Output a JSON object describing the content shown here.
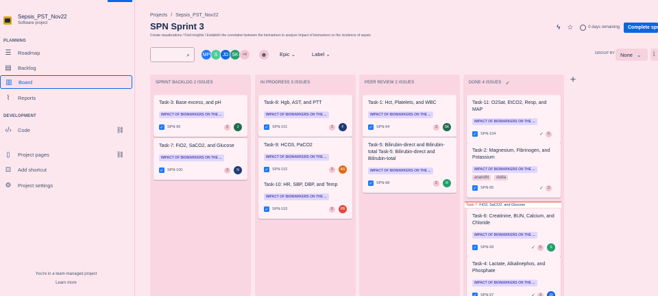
{
  "sidebar": {
    "project_name": "Sepsis_PST_Nov22",
    "project_type": "Software project",
    "planning_heading": "PLANNING",
    "development_heading": "DEVELOPMENT",
    "items": [
      {
        "label": "Roadmap",
        "icon": "roadmap-icon"
      },
      {
        "label": "Backlog",
        "icon": "backlog-icon"
      },
      {
        "label": "Board",
        "icon": "board-icon"
      },
      {
        "label": "Reports",
        "icon": "reports-icon"
      },
      {
        "label": "Code",
        "icon": "code-icon"
      },
      {
        "label": "Project pages",
        "icon": "pages-icon"
      },
      {
        "label": "Add shortcut",
        "icon": "shortcut-icon"
      },
      {
        "label": "Project settings",
        "icon": "settings-icon"
      }
    ],
    "team_note": "You're in a team-managed project",
    "learn_more": "Learn more"
  },
  "header": {
    "breadcrumb_projects": "Projects",
    "breadcrumb_sep": "/",
    "breadcrumb_project": "Sepsis_PST_Nov22",
    "title": "SPN Sprint 3",
    "description": "Create visualizations / Find insights / Establish the correlation between the biomarkers to analyze Impact of biomarkers on the incidence of sepsis",
    "days_remaining": "0 days remaining",
    "complete_sprint": "Complete sprint"
  },
  "filters": {
    "avatars": [
      {
        "initials": "MP",
        "color": "#1d7afc"
      },
      {
        "initials": "S",
        "color": "#4bce97"
      },
      {
        "initials": "JD",
        "color": "#0c66e4"
      },
      {
        "initials": "SK",
        "color": "#22a06b"
      }
    ],
    "more_count": "+6",
    "epic": "Epic",
    "label": "Label",
    "group_by": "GROUP BY",
    "group_value": "None"
  },
  "columns": [
    {
      "header": "SPRINT BACKLOG 2 ISSUES",
      "cards": [
        {
          "title": "Task-3: Base excess, and pH",
          "epic": "IMPACT OF BIOMARKERS ON THE ...",
          "key": "SPN-96",
          "estimate": "2",
          "assignee": "J",
          "assignee_color": "#216e4e"
        },
        {
          "title": "Task-7: FiO2, SaCO2, and Glucose",
          "epic": "IMPACT OF BIOMARKERS ON THE ...",
          "key": "SPN-100",
          "estimate": "3",
          "assignee": "N",
          "assignee_color": "#1f3a75"
        }
      ]
    },
    {
      "header": "IN PROGRESS 3 ISSUES",
      "cards": [
        {
          "title": "Task-8: Hgb, AST, and PTT",
          "epic": "IMPACT OF BIOMARKERS ON THE ...",
          "key": "SPN-101",
          "estimate": "3",
          "assignee": "F",
          "assignee_color": "#1f3a75"
        },
        {
          "title": "Task-9: HCO3, PaCO2",
          "epic": "IMPACT OF BIOMARKERS ON THE ...",
          "key": "SPN-102",
          "estimate": "3",
          "assignee": "AS",
          "assignee_color": "#e56910"
        },
        {
          "title": "Task-10: HR, SBP, DBP, and Temp",
          "epic": "IMPACT OF BIOMARKERS ON THE ...",
          "key": "SPN-103",
          "estimate": "5",
          "assignee": "PB",
          "assignee_color": "#e2483d"
        }
      ]
    },
    {
      "header": "PEER REVIEW 2 ISSUES",
      "cards": [
        {
          "title": "Task-1: Hct, Platelets, and WBC",
          "epic": "IMPACT OF BIOMARKERS ON THE ...",
          "key": "SPN-94",
          "estimate": "3",
          "assignee": "SK",
          "assignee_color": "#216e4e"
        },
        {
          "title": "Task-5: Bilirubin-direct and Bilirubin-total Task-5: Bilirubin-direct and Bilirubin-total",
          "epic": "IMPACT OF BIOMARKERS ON THE ...",
          "key": "SPN-98",
          "estimate": "2",
          "assignee": "R",
          "assignee_color": "#22a06b"
        }
      ]
    },
    {
      "header": "DONE 4 ISSUES",
      "cards": [
        {
          "title": "Task-11: O2Sat, EtCO2, Resp, and MAP",
          "epic": "IMPACT OF BIOMARKERS ON THE ...",
          "key": "SPN-104",
          "estimate": "5",
          "assignee": ""
        },
        {
          "title": "Task-2: Magnesium, Fibrinogen, and Potassium",
          "epic": "IMPACT OF BIOMARKERS ON THE ...",
          "labels": [
            "anandhi",
            "stella"
          ],
          "key": "SPN-95",
          "estimate": "3",
          "assignee": ""
        },
        {
          "title": "Task-6: Creatinine, BUN, Calcium, and Chloride",
          "epic": "IMPACT OF BIOMARKERS ON THE ...",
          "key": "SPN-99",
          "estimate": "5",
          "assignee": "S",
          "assignee_color": "#22a06b"
        },
        {
          "title": "Task-4: Lactate, Alkalinephos, and Phosphate",
          "epic": "IMPACT OF BIOMARKERS ON THE ...",
          "key": "SPN-97",
          "estimate": "3",
          "assignee": "JD",
          "assignee_color": "#0c66e4"
        }
      ]
    }
  ],
  "drag_tooltip": {
    "key": "Task-7:",
    "text": "FiO2, SaCO2, and Glucose"
  }
}
